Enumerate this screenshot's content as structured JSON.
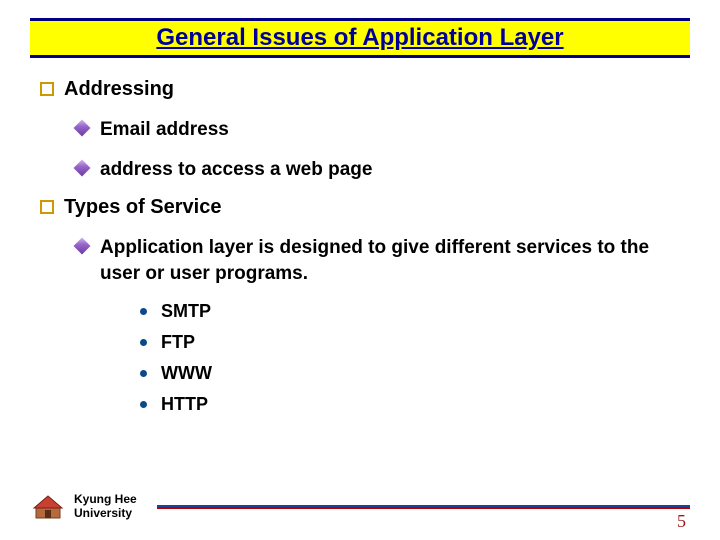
{
  "title": "General Issues of Application Layer",
  "sections": [
    {
      "heading": "Addressing",
      "items": [
        {
          "text": "Email address"
        },
        {
          "text": "address to access a web page"
        }
      ]
    },
    {
      "heading": "Types of Service",
      "items": [
        {
          "text": "Application layer is designed to give different services to the user or user programs.",
          "subitems": [
            "SMTP",
            "FTP",
            "WWW",
            "HTTP"
          ]
        }
      ]
    }
  ],
  "footer": {
    "org_line1": "Kyung Hee",
    "org_line2": "University"
  },
  "page_number": "5"
}
